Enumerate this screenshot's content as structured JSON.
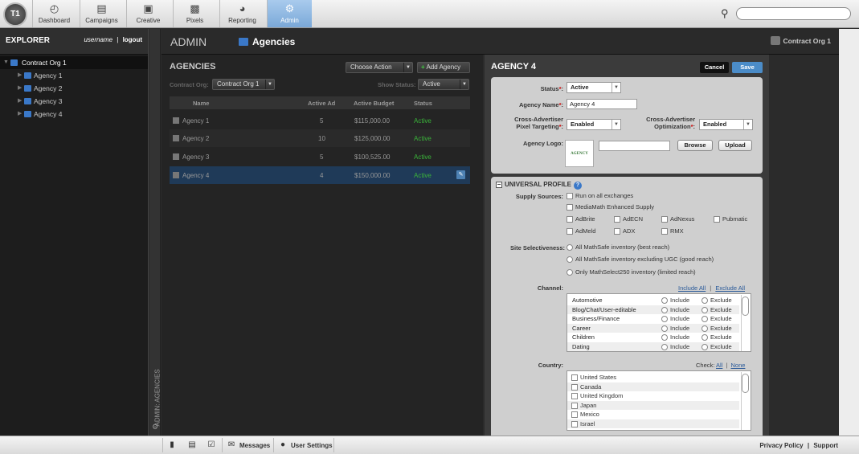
{
  "nav": {
    "logo": "T1",
    "items": [
      {
        "label": "Dashboard",
        "icon": "dashboard-icon"
      },
      {
        "label": "Campaigns",
        "icon": "campaigns-icon"
      },
      {
        "label": "Creative",
        "icon": "creative-icon"
      },
      {
        "label": "Pixels",
        "icon": "pixels-icon"
      },
      {
        "label": "Reporting",
        "icon": "reporting-icon"
      },
      {
        "label": "Admin",
        "icon": "gear-icon",
        "active": true
      }
    ],
    "search_placeholder": ""
  },
  "explorer": {
    "title": "EXPLORER",
    "username": "username",
    "separator": "|",
    "logout": "logout",
    "tree": [
      {
        "label": "Contract Org 1",
        "level": 0
      },
      {
        "label": "Agency 1",
        "level": 1
      },
      {
        "label": "Agency 2",
        "level": 1
      },
      {
        "label": "Agency 3",
        "level": 1
      },
      {
        "label": "Agency 4",
        "level": 1
      }
    ]
  },
  "vbar": {
    "label": "ADMIN: AGENCIES"
  },
  "header": {
    "section": "ADMIN",
    "page": "Agencies",
    "org": "Contract Org 1"
  },
  "list": {
    "title": "AGENCIES",
    "choose_action": "Choose Action",
    "add_agency": "Add Agency",
    "contract_org_label": "Contract Org:",
    "contract_org_value": "Contract Org 1",
    "show_status_label": "Show Status:",
    "show_status_value": "Active",
    "columns": [
      "Name",
      "Active Ad",
      "Active Budget",
      "Status"
    ],
    "rows": [
      {
        "name": "Agency 1",
        "active_ad": "5",
        "budget": "$115,000.00",
        "status": "Active"
      },
      {
        "name": "Agency 2",
        "active_ad": "10",
        "budget": "$125,000.00",
        "status": "Active"
      },
      {
        "name": "Agency 3",
        "active_ad": "5",
        "budget": "$100,525.00",
        "status": "Active"
      },
      {
        "name": "Agency 4",
        "active_ad": "4",
        "budget": "$150,000.00",
        "status": "Active",
        "selected": true
      }
    ]
  },
  "detail": {
    "title": "AGENCY 4",
    "cancel": "Cancel",
    "save": "Save",
    "status_label": "Status",
    "status_value": "Active",
    "name_label": "Agency Name",
    "name_value": "Agency 4",
    "pixel_label_1": "Cross-Advertiser",
    "pixel_label_2": "Pixel Targeting",
    "pixel_value": "Enabled",
    "opt_label_1": "Cross-Advertiser",
    "opt_label_2": "Optimization",
    "opt_value": "Enabled",
    "logo_label": "Agency Logo:",
    "logo_text": "AGENCY",
    "browse": "Browse",
    "upload": "Upload",
    "req_mark": "*",
    "colon": ":",
    "up_title": "UNIVERSAL PROFILE",
    "help": "?",
    "supply_label": "Supply Sources:",
    "supply_opts": [
      "Run on all exchanges",
      "MediaMath Enhanced Supply"
    ],
    "exchanges_row1": [
      "AdBrite",
      "AdECN",
      "AdNexus",
      "Pubmatic"
    ],
    "exchanges_row2": [
      "AdMeld",
      "ADX",
      "RMX"
    ],
    "site_label": "Site Selectiveness:",
    "site_opts": [
      "All MathSafe inventory (best reach)",
      "All MathSafe inventory excluding UGC (good reach)",
      "Only MathSelect250 inventory (limited reach)"
    ],
    "channel_label": "Channel:",
    "include_all": "Include All",
    "exclude_all": "Exclude All",
    "link_sep": "|",
    "include": "Include",
    "exclude": "Exclude",
    "channels": [
      "Automotive",
      "Blog/Chat/User-editable",
      "Business/Finance",
      "Career",
      "Children",
      "Dating"
    ],
    "country_label": "Country:",
    "check_label": "Check:",
    "check_all": "All",
    "check_none": "None",
    "countries": [
      "United States",
      "Canada",
      "United Kingdom",
      "Japan",
      "Mexico",
      "Israel"
    ]
  },
  "bottom": {
    "messages": "Messages",
    "user_settings": "User Settings",
    "privacy": "Privacy Policy",
    "sep": "|",
    "support": "Support"
  }
}
